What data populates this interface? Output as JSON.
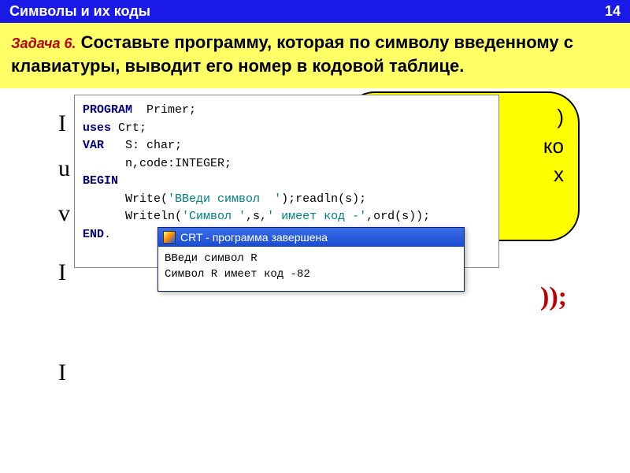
{
  "header": {
    "title": "Символы  и их коды",
    "page_number": "14"
  },
  "task": {
    "label": "Задача 6.",
    "text": "Составьте программу, которая по символу введенному с клавиатуры, выводит его номер в кодовой таблице."
  },
  "fragments": {
    "left": [
      "I",
      "u",
      "v",
      "",
      "I",
      "",
      "",
      "I"
    ],
    "yellow": [
      ")",
      "ко",
      "",
      "х"
    ],
    "red": "));"
  },
  "code": {
    "l1a": "PROGRAM",
    "l1b": "  Primer;",
    "l2a": "uses",
    "l2b": " Crt;",
    "l3a": "VAR",
    "l3b": "   S: char;",
    "l4": "      n,code:INTEGER;",
    "l5a": "BEGIN",
    "l6a": "      Write(",
    "l6s": "'ВВеди символ  '",
    "l6b": ");readln(s);",
    "l7a": "      Writeln(",
    "l7s1": "'Символ '",
    "l7m": ",s,",
    "l7s2": "' имеет код -'",
    "l7e": ",ord(s));",
    "l8a": "END",
    "l8b": "."
  },
  "crt": {
    "title": "CRT - программа завершена",
    "line1": "ВВеди символ  R",
    "line2": "Символ R имеет код -82"
  }
}
